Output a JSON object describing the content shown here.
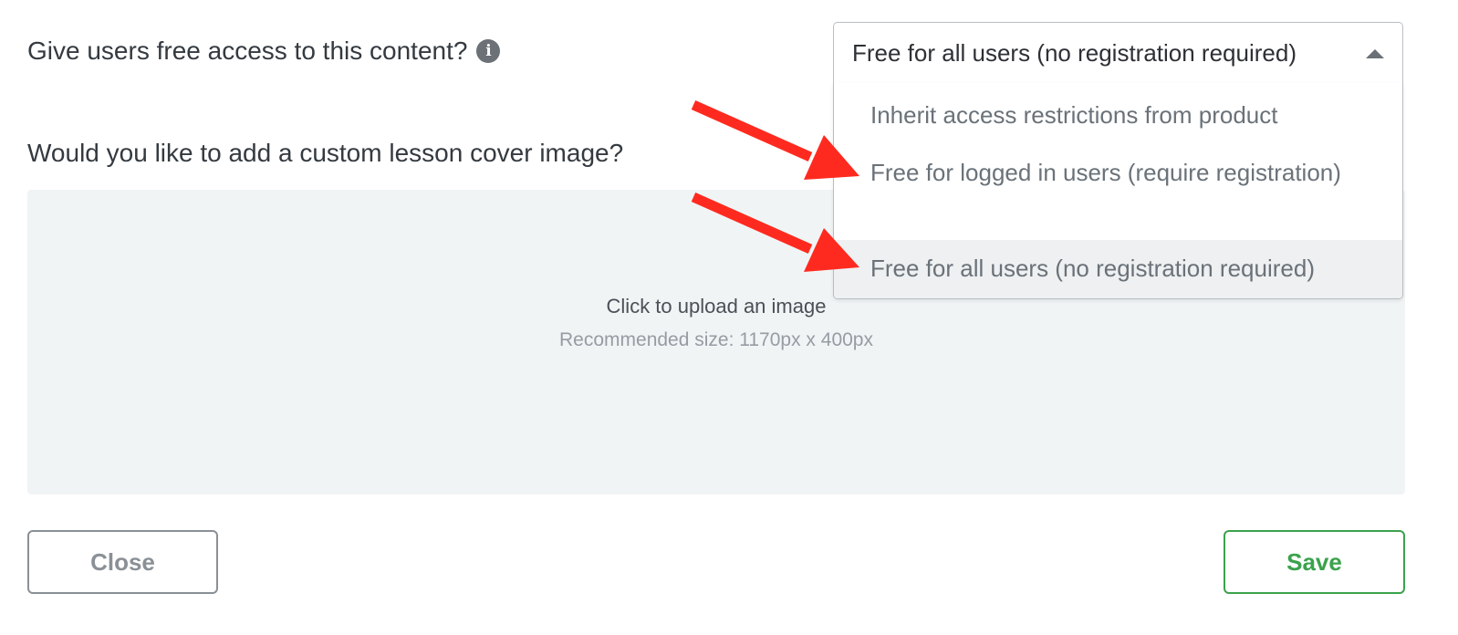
{
  "form": {
    "access_question": "Give users free access to this content?",
    "cover_question": "Would you like to add a custom lesson cover image?"
  },
  "access_select": {
    "selected_value": "Free for all users (no registration required)",
    "options": [
      {
        "label": "Inherit access restrictions from product"
      },
      {
        "label": "Free for logged in users (require registration)"
      },
      {
        "label": "Free for all users (no registration required)"
      }
    ],
    "highlighted_index": 2
  },
  "upload": {
    "title": "Click to upload an image",
    "hint": "Recommended size: 1170px x 400px"
  },
  "buttons": {
    "close_label": "Close",
    "save_label": "Save"
  },
  "icons": {
    "info": "info-icon",
    "caret": "caret-up-icon"
  },
  "colors": {
    "save_accent": "#3ba24c",
    "annotation_arrow": "#ff2a1f"
  }
}
